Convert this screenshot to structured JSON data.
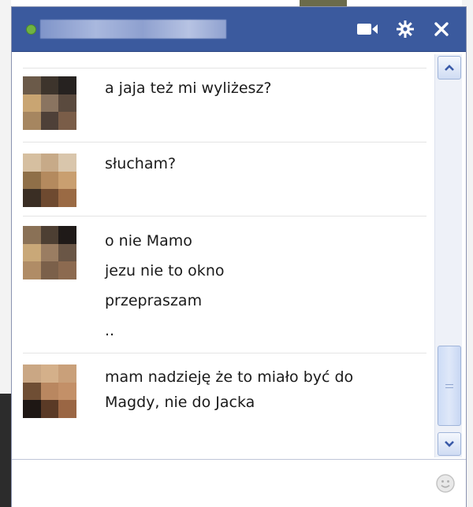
{
  "chat": {
    "title_bar": {
      "icons": [
        "status-online-icon",
        "video-call-icon",
        "gear-icon",
        "close-icon"
      ]
    },
    "messages": [
      {
        "lines": [
          "a jaja też mi wyliżesz?"
        ]
      },
      {
        "lines": [
          "słucham?"
        ]
      },
      {
        "lines": [
          "o nie Mamo",
          "jezu nie to okno",
          "przepraszam",
          ".."
        ]
      },
      {
        "lines": [
          "mam nadzieję że to miało być do",
          "Magdy, nie do Jacka"
        ]
      }
    ],
    "input": {
      "value": "",
      "placeholder": ""
    },
    "colors": {
      "titlebar": "#3b5a9e",
      "status_online": "#6fb243",
      "scrollbar_track": "#eef1f8"
    }
  }
}
